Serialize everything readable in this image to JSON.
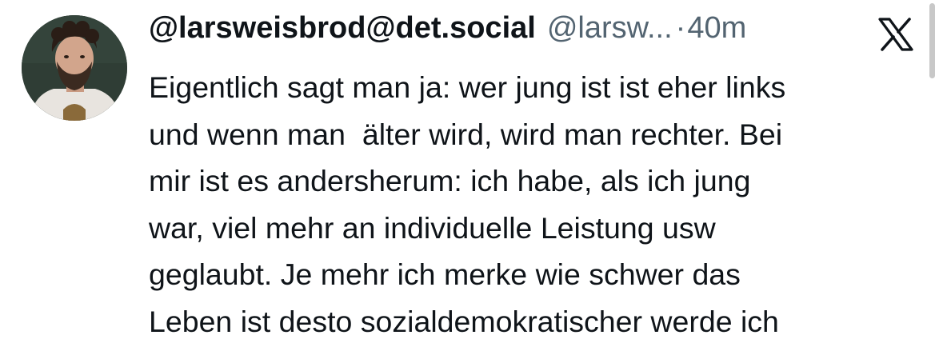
{
  "tweet": {
    "display_name": "@larsweisbrod@det.social",
    "handle": "@larsw...",
    "separator": "·",
    "timestamp": "40m",
    "body_lines": [
      "Eigentlich sagt man ja: wer jung ist ist eher links",
      "und wenn man  älter wird, wird man rechter. Bei",
      "mir ist es andersherum: ich habe, als ich jung",
      "war, viel mehr an individuelle Leistung usw",
      "geglaubt. Je mehr ich merke wie schwer das",
      "Leben ist desto sozialdemokratischer werde ich"
    ]
  },
  "icons": {
    "platform_logo": "x-logo-icon",
    "avatar": "avatar-photo"
  },
  "colors": {
    "text_primary": "#0f1419",
    "text_secondary": "#536471",
    "background": "#ffffff"
  }
}
